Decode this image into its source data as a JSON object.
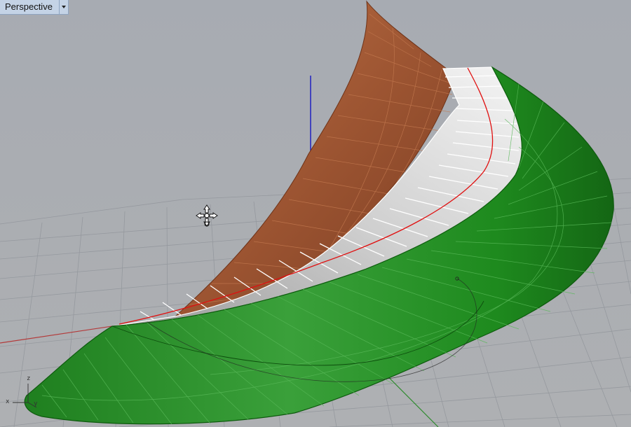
{
  "viewport": {
    "title": "Perspective"
  },
  "axis_icon": {
    "z": "z",
    "x": "x",
    "y": "y"
  },
  "colors": {
    "background": "#a9acb1",
    "grid": "#8e9298",
    "x_axis": "#b33a3a",
    "y_axis": "#2e8b2e",
    "z_axis": "#2020c0",
    "brown_surface": "#9a5230",
    "green_surface": "#228b22",
    "white_strip": "#e8e8e8",
    "center_curve": "#e01010"
  }
}
